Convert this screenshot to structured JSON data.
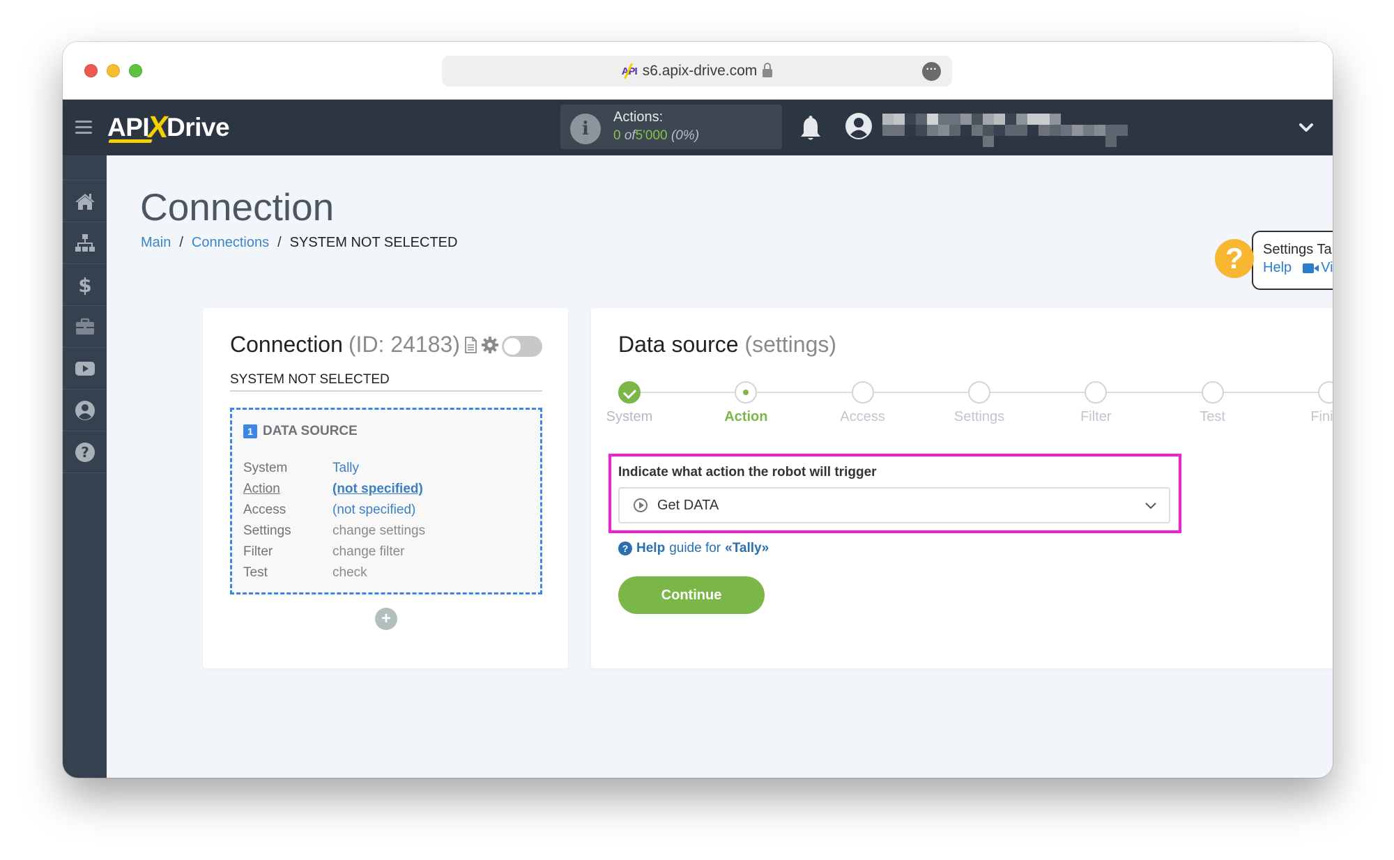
{
  "browser": {
    "url": "s6.apix-drive.com",
    "favicon_text": "API"
  },
  "header": {
    "logo_left": "API",
    "logo_x": "X",
    "logo_right": "Drive",
    "actions_label": "Actions:",
    "actions_used": "0",
    "actions_of": "of",
    "actions_total": "5'000",
    "actions_percent": "(0%)",
    "username_redacted": true
  },
  "sidebar": {
    "items": [
      {
        "icon": "home-icon"
      },
      {
        "icon": "sitemap-icon"
      },
      {
        "icon": "dollar-icon"
      },
      {
        "icon": "briefcase-icon"
      },
      {
        "icon": "youtube-icon"
      },
      {
        "icon": "user-circle-icon"
      },
      {
        "icon": "question-circle-icon"
      }
    ]
  },
  "page": {
    "title": "Connection",
    "breadcrumb": [
      {
        "label": "Main",
        "link": true
      },
      {
        "label": "Connections",
        "link": true
      },
      {
        "label": "SYSTEM NOT SELECTED",
        "link": false
      }
    ],
    "breadcrumb_sep": "/"
  },
  "help_widget": {
    "title": "Settings Tally",
    "help_label": "Help",
    "video_label": "Video",
    "icon_glyph": "?"
  },
  "connection_card": {
    "title": "Connection",
    "id_text": "(ID: 24183)",
    "toggle_on": false,
    "system_status": "SYSTEM NOT SELECTED",
    "data_source": {
      "number": "1",
      "heading": "DATA SOURCE",
      "rows": [
        {
          "key": "System",
          "value": "Tally",
          "style": "blue"
        },
        {
          "key": "Action",
          "value": "(not specified)",
          "style": "blue-bold"
        },
        {
          "key": "Access",
          "value": "(not specified)",
          "style": "blue"
        },
        {
          "key": "Settings",
          "value": "change settings",
          "style": "gray"
        },
        {
          "key": "Filter",
          "value": "change filter",
          "style": "gray"
        },
        {
          "key": "Test",
          "value": "check",
          "style": "gray"
        }
      ]
    },
    "add_glyph": "+"
  },
  "settings_card": {
    "title": "Data source",
    "subtitle": "(settings)",
    "steps": [
      {
        "label": "System",
        "state": "done"
      },
      {
        "label": "Action",
        "state": "active"
      },
      {
        "label": "Access",
        "state": "pending"
      },
      {
        "label": "Settings",
        "state": "pending"
      },
      {
        "label": "Filter",
        "state": "pending"
      },
      {
        "label": "Test",
        "state": "pending"
      },
      {
        "label": "Finish",
        "state": "pending"
      }
    ],
    "field_label": "Indicate what action the robot will trigger",
    "selected_action": "Get DATA",
    "help_guide_bold": "Help",
    "help_guide_text": "guide for",
    "help_guide_target": "«Tally»",
    "continue_label": "Continue"
  },
  "colors": {
    "header_bg": "#2c3643",
    "sidebar_bg": "#35414f",
    "accent_green": "#7ab648",
    "link_blue": "#3a86c8",
    "dashed_blue": "#3b87e6",
    "highlight_magenta": "#f020d8",
    "help_yellow": "#f7b731"
  }
}
